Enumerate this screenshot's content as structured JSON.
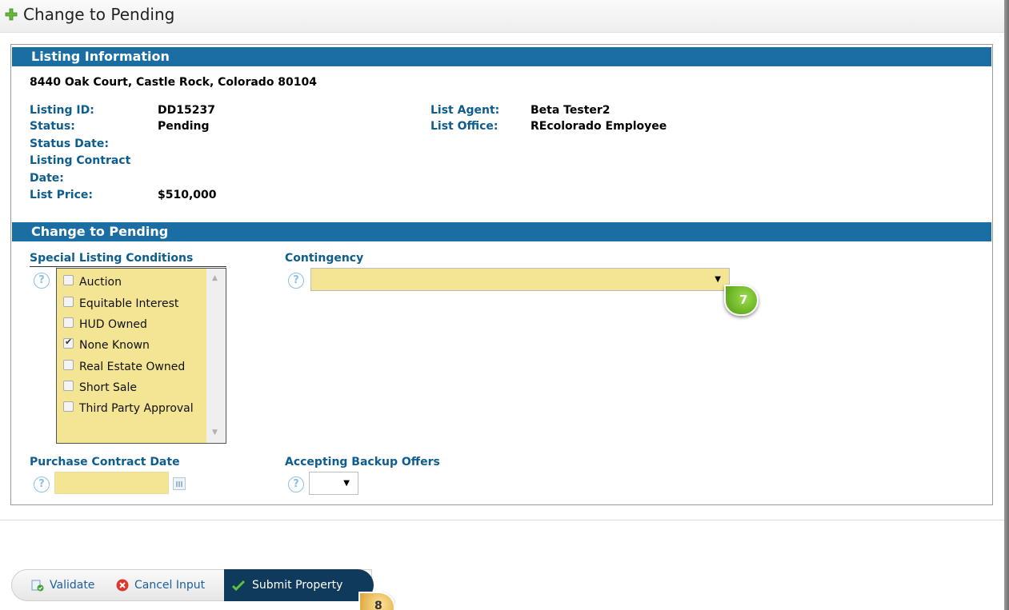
{
  "header": {
    "title": "Change to Pending"
  },
  "listing_info": {
    "section_title": "Listing Information",
    "address": "8440 Oak Court, Castle Rock, Colorado 80104",
    "listing_id_label": "Listing ID:",
    "listing_id": "DD15237",
    "status_label": "Status:",
    "status": "Pending",
    "status_date_label": "Status Date:",
    "listing_contract_label_line1": "Listing Contract",
    "listing_contract_label_line2": "Date:",
    "list_price_label": "List Price:",
    "list_price": "$510,000",
    "list_agent_label": "List Agent:",
    "list_agent": "Beta Tester2",
    "list_office_label": "List Office:",
    "list_office": "REcolorado Employee"
  },
  "pending": {
    "section_title": "Change to Pending",
    "special_conditions_label": "Special Listing Conditions",
    "special_conditions": [
      {
        "label": "Auction",
        "checked": false
      },
      {
        "label": "Equitable Interest",
        "checked": false
      },
      {
        "label": "HUD Owned",
        "checked": false
      },
      {
        "label": "None Known",
        "checked": true
      },
      {
        "label": "Real Estate Owned",
        "checked": false
      },
      {
        "label": "Short Sale",
        "checked": false
      },
      {
        "label": "Third Party Approval",
        "checked": false
      }
    ],
    "contingency_label": "Contingency",
    "contingency_value": "",
    "purchase_contract_label": "Purchase Contract Date",
    "purchase_contract_value": "",
    "backup_offers_label": "Accepting Backup Offers",
    "backup_offers_value": "",
    "help_glyph": "?"
  },
  "badges": {
    "step7": "7",
    "step8": "8"
  },
  "toolbar": {
    "validate": "Validate",
    "cancel": "Cancel Input",
    "submit": "Submit Property"
  },
  "colors": {
    "section_bar": "#1b6ea3",
    "field_yellow": "#f3e593",
    "label_blue": "#0e5d8f",
    "submit_bg": "#0f3a5c"
  }
}
